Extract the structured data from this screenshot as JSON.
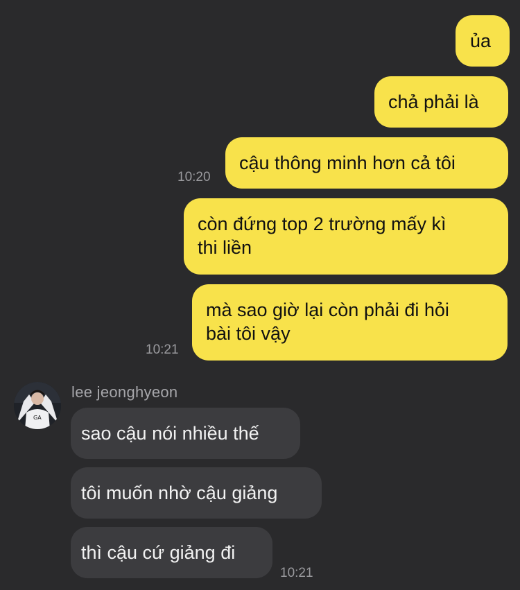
{
  "colors": {
    "background": "#2a2a2c",
    "sent_bubble": "#f8e24b",
    "received_bubble": "#3c3c3f",
    "timestamp": "#9a9a9e"
  },
  "conversation": {
    "sent": [
      {
        "text": "ủa"
      },
      {
        "text": "chả phải là"
      },
      {
        "text": "cậu thông minh hơn cả tôi",
        "time": "10:20"
      },
      {
        "lines": [
          "còn đứng top 2 trường mấy kì",
          "thi liền"
        ]
      },
      {
        "lines": [
          "mà sao giờ lại còn phải đi hỏi",
          "bài tôi vậy"
        ],
        "time": "10:21"
      }
    ],
    "contact": {
      "name": "lee jeonghyeon",
      "avatar_icon": "profile-photo-icon"
    },
    "received": [
      {
        "text": "sao cậu nói nhiều thế"
      },
      {
        "text": "tôi muốn nhờ cậu giảng"
      },
      {
        "text": "thì cậu cứ giảng đi",
        "time": "10:21"
      }
    ]
  }
}
